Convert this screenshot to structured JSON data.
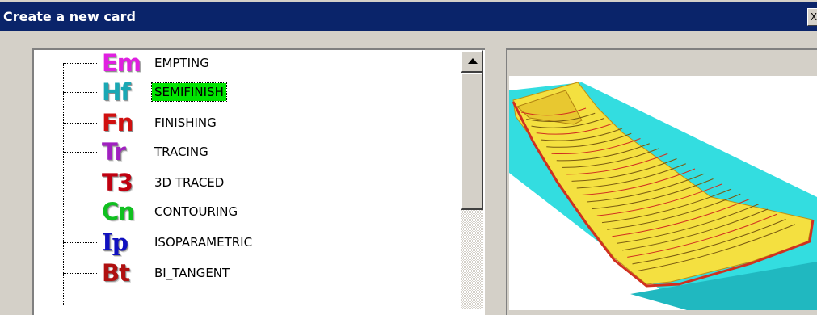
{
  "window": {
    "title": "Create a new card",
    "close_glyph": "X"
  },
  "tree": {
    "items": [
      {
        "icon_text": "Em",
        "label": "EMPTING",
        "color": "#e020e0",
        "selected": false
      },
      {
        "icon_text": "Hf",
        "label": "SEMIFINISH",
        "color": "#1aa8b4",
        "selected": true
      },
      {
        "icon_text": "Fn",
        "label": "FINISHING",
        "color": "#d01010",
        "selected": false
      },
      {
        "icon_text": "Tr",
        "label": "TRACING",
        "color": "#a020c0",
        "selected": false
      },
      {
        "icon_text": "T3",
        "label": "3D TRACED",
        "color": "#c00010",
        "selected": false
      },
      {
        "icon_text": "Cn",
        "label": "CONTOURING",
        "color": "#10c020",
        "selected": false
      },
      {
        "icon_text": "Ip",
        "label": "ISOPARAMETRIC",
        "color": "#1010c0",
        "selected": false
      },
      {
        "icon_text": "Bt",
        "label": "BI_TANGENT",
        "color": "#b01010",
        "selected": false
      }
    ]
  },
  "colors": {
    "titlebar": "#0a246a",
    "selection": "#00e400",
    "preview_block": "#33dde0",
    "preview_part": "#f4e040",
    "toolpath": "#d03020"
  }
}
